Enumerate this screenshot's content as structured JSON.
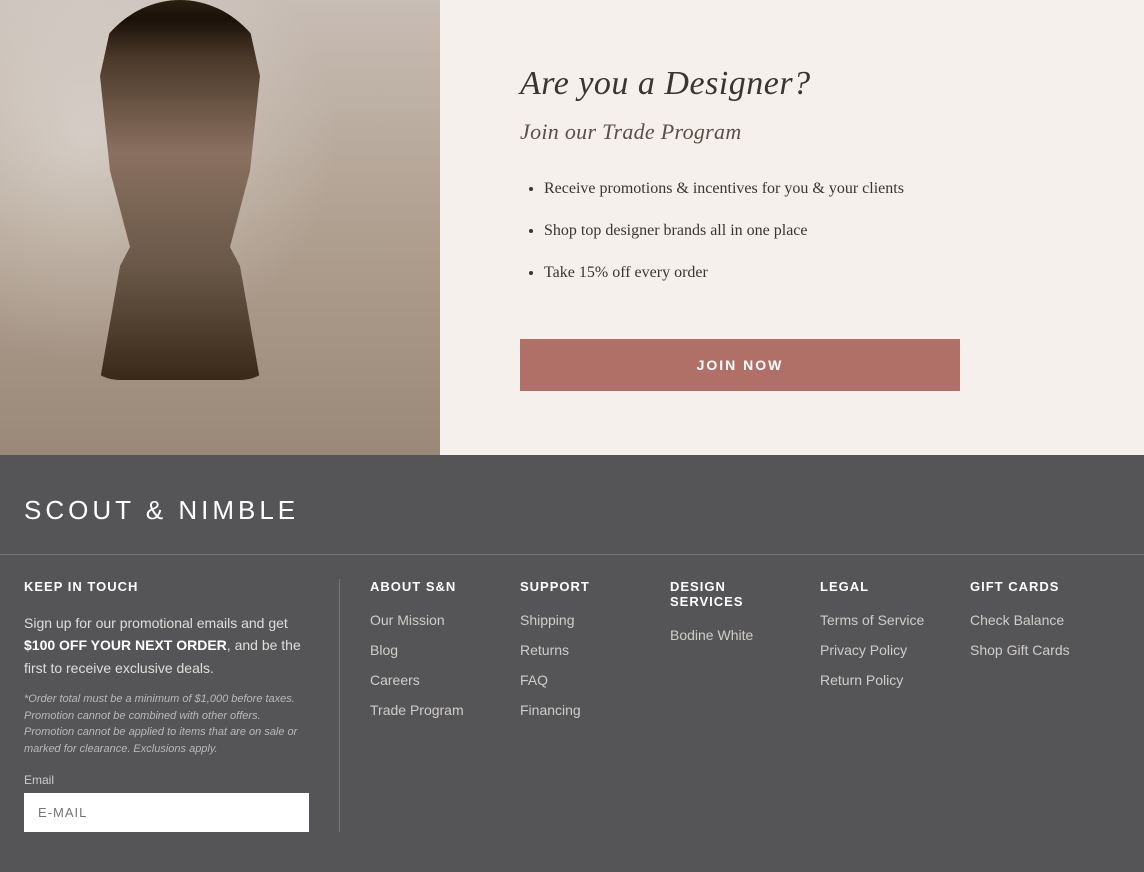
{
  "hero": {
    "title": "Are you a Designer?",
    "subtitle": "Join our Trade Program",
    "bullets": [
      "Receive promotions & incentives for you & your clients",
      "Shop top designer brands all in one place",
      "Take 15% off every order"
    ],
    "join_button_label": "JOIN NOW"
  },
  "footer": {
    "logo": "SCOUT & NIMBLE",
    "columns": {
      "keep_in_touch": {
        "title": "KEEP IN TOUCH",
        "main_text_1": "Sign up for our promotional emails and get ",
        "highlight": "$100 OFF YOUR NEXT ORDER",
        "main_text_2": ", and be the first to receive exclusive deals.",
        "fine_print": "*Order total must be a minimum of $1,000 before taxes. Promotion cannot be combined with other offers. Promotion cannot be applied to items that are on sale or marked for clearance. Exclusions apply.",
        "email_label": "Email",
        "email_placeholder": "E-MAIL"
      },
      "about": {
        "title": "ABOUT S&N",
        "links": [
          "Our Mission",
          "Blog",
          "Careers",
          "Trade Program"
        ]
      },
      "support": {
        "title": "SUPPORT",
        "links": [
          "Shipping",
          "Returns",
          "FAQ",
          "Financing"
        ]
      },
      "design_services": {
        "title": "DESIGN SERVICES",
        "links": [
          "Bodine White"
        ]
      },
      "legal": {
        "title": "LEGAL",
        "links": [
          "Terms of Service",
          "Privacy Policy",
          "Return Policy"
        ]
      },
      "gift_cards": {
        "title": "GIFT CARDS",
        "links": [
          "Check Balance",
          "Shop Gift Cards"
        ]
      }
    }
  }
}
